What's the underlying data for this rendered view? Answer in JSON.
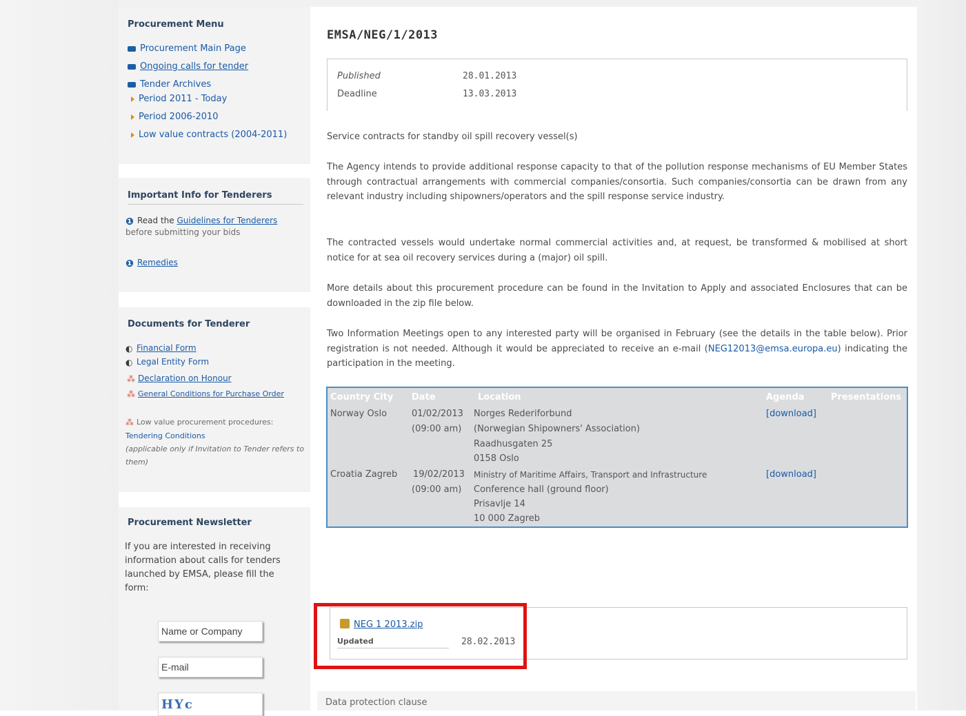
{
  "sidebar": {
    "procurement_menu": {
      "title": "Procurement Menu",
      "items": [
        {
          "label": "Procurement Main Page"
        },
        {
          "label": "Ongoing calls for tender"
        },
        {
          "label": "Tender Archives"
        }
      ],
      "archives": [
        {
          "label": "Period 2011 - Today"
        },
        {
          "label": "Period 2006-2010"
        },
        {
          "label": "Low value contracts (2004-2011)"
        }
      ]
    },
    "important_info": {
      "title": "Important Info for Tenderers",
      "read_prefix": "Read the",
      "guidelines_link": "Guidelines for Tenderers",
      "read_suffix": "before submitting your bids",
      "remedies_link": "Remedies"
    },
    "documents": {
      "title": "Documents for Tenderer",
      "financial_form": "Financial Form",
      "legal_entity_form": "Legal Entity Form",
      "declaration": "Declaration on Honour",
      "general_conditions": "General Conditions for Purchase Order",
      "low_value_prefix": "Low value procurement procedures:",
      "tendering_conditions": "Tendering Conditions",
      "applicability_note": "(applicable only if Invitation to Tender refers to them)"
    },
    "newsletter": {
      "title": "Procurement Newsletter",
      "text": "If you are interested in receiving information about calls for tenders launched by EMSA, please fill the form:",
      "name_placeholder": "Name or Company",
      "email_placeholder": "E-mail",
      "captcha_text": "HYc"
    }
  },
  "main": {
    "title": "EMSA/NEG/1/2013",
    "published_label": "Published",
    "published_value": "28.01.2013",
    "deadline_label": "Deadline",
    "deadline_value": "13.03.2013",
    "subtitle": "Service contracts for standby oil spill recovery vessel(s)",
    "para1": "The Agency intends to provide additional response capacity to that of the pollution response mechanisms of EU Member States through contractual arrangements with commercial companies/consortia. Such companies/consortia can be drawn from any relevant industry including shipowners/operators and the spill response service industry.",
    "para2": "The contracted vessels would undertake normal commercial activities and, at request, be transformed & mobilised at short notice for at sea oil recovery services during a (major) oil spill.",
    "para3": "More details about this procurement procedure can be found in the Invitation to Apply and associated Enclosures that can be downloaded in the zip file below.",
    "para4_pre": "Two Information Meetings open to any interested party will be organised in February (see the details in the table below). Prior registration is not needed. Although it would be appreciated to receive an e-mail (",
    "para4_email": "NEG12013@emsa.europa.eu",
    "para4_post": ") indicating the participation in the meeting.",
    "schedule": {
      "headers": {
        "country_city": "Country City",
        "date": "Date",
        "location": "Location",
        "agenda": "Agenda",
        "presentations": "Presentations"
      },
      "rows": [
        {
          "country_city": "Norway Oslo",
          "date": "01/02/2013",
          "time": "(09:00 am)",
          "location": [
            "Norges Rederiforbund",
            "(Norwegian Shipowners' Association)",
            "Raadhusgaten 25",
            "0158 Oslo"
          ],
          "agenda": "[download]"
        },
        {
          "country_city": "Croatia Zagreb",
          "date": "19/02/2013",
          "time": "(09:00 am)",
          "location": [
            "Ministry of Maritime Affairs, Transport and Infrastructure",
            "Conference hall (ground floor)",
            "Prisavlje 14",
            "10 000 Zagreb"
          ],
          "agenda": "[download]"
        }
      ]
    },
    "download": {
      "file_link": "NEG 1 2013.zip",
      "updated_label": "Updated",
      "updated_value": "28.02.2013"
    },
    "footer_text": "Data protection clause"
  }
}
